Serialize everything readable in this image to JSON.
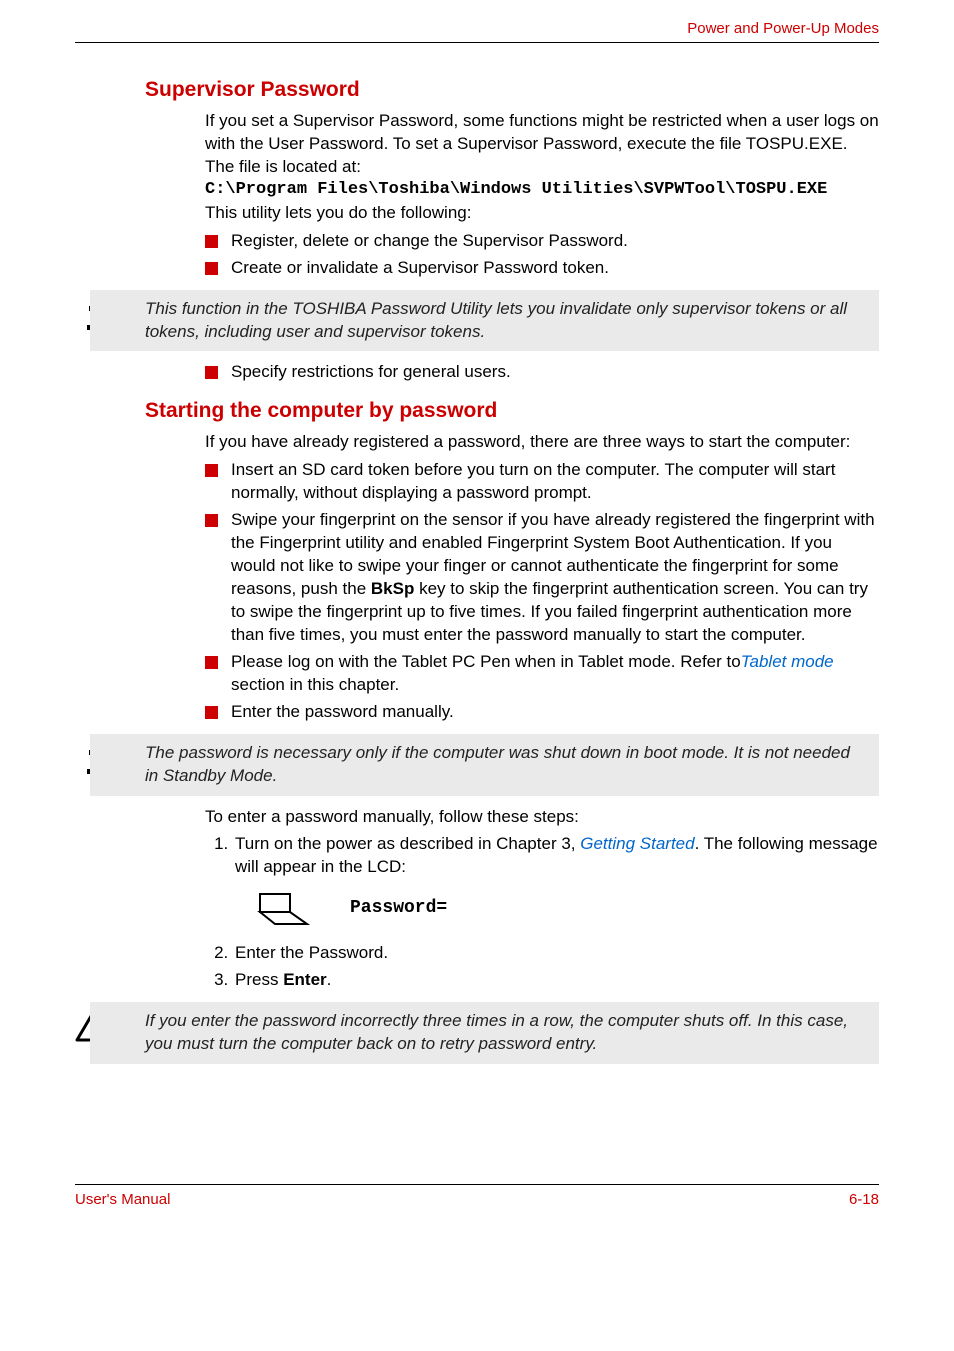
{
  "header": {
    "crumb": "Power and Power-Up Modes"
  },
  "s1": {
    "title": "Supervisor Password",
    "p1": "If you set a Supervisor Password, some functions might be restricted when a user logs on with the User Password. To set a Supervisor Password, execute the file TOSPU.EXE. The file is located at:",
    "code1": "C:\\Program Files\\Toshiba\\Windows Utilities\\SVPWTool\\TOSPU.EXE",
    "p2": "This utility lets you do the following:",
    "bullets1": [
      "Register, delete or change the Supervisor Password.",
      "Create or invalidate a Supervisor Password token."
    ],
    "note1": "This function in the TOSHIBA Password Utility lets you invalidate only supervisor tokens or all tokens, including user and supervisor tokens.",
    "bullets2": [
      "Specify restrictions for general users."
    ]
  },
  "s2": {
    "title": "Starting the computer by password",
    "p1": "If you have already registered a password, there are three ways to start the computer:",
    "b1": "Insert an SD card token before you turn on the computer. The computer will start normally, without displaying a password prompt.",
    "b2a": "Swipe your fingerprint on the sensor if you have already registered the fingerprint with the Fingerprint utility and enabled Fingerprint System Boot Authentication. If you would not like to swipe your finger or cannot authenticate the fingerprint for some reasons, push the ",
    "b2key": "BkSp",
    "b2b": " key to skip the fingerprint authentication screen. You can try to swipe the fingerprint up to five times. If you failed fingerprint authentication more than five times, you must enter the password manually to start the computer.",
    "b3a": "Please log on with the Tablet PC Pen when in Tablet mode. Refer to",
    "b3link": "Tablet mode",
    "b3b": " section in this chapter.",
    "b4": "Enter the password manually.",
    "note2": "The password is necessary only if the computer was shut down in boot mode. It is not needed in Standby Mode.",
    "p2": "To enter a password manually, follow these steps:",
    "step1a": "Turn on the power as described in Chapter 3, ",
    "step1link": "Getting Started",
    "step1b": ". The following message will appear in the LCD:",
    "prompt": "Password=",
    "step2": "Enter the Password.",
    "step3a": "Press ",
    "step3key": "Enter",
    "step3b": ".",
    "caution": "If you enter the password incorrectly three times in a row, the computer shuts off. In this case, you must turn the computer back on to retry password entry."
  },
  "footer": {
    "left": "User's Manual",
    "right": "6-18"
  }
}
